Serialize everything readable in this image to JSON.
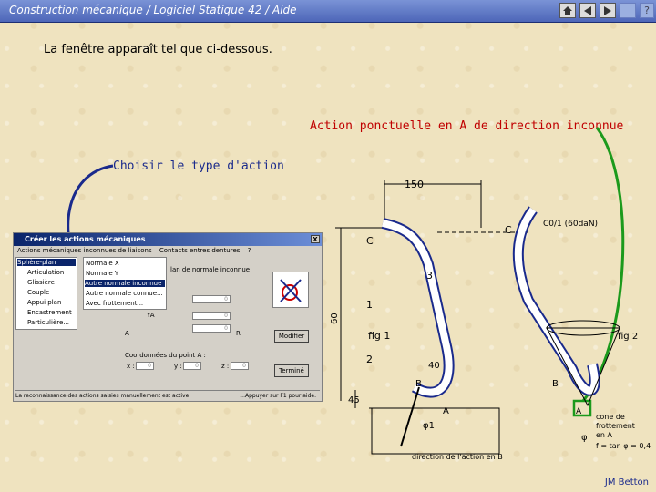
{
  "titlebar": {
    "title_prefix": "Construction mécanique",
    "title_sep": "/",
    "title_main": "Logiciel Statique 42 / Aide",
    "nav_icons": [
      "home-icon",
      "back-icon",
      "forward-icon",
      "blank-icon",
      "help-icon"
    ],
    "help_label": "?"
  },
  "intro": "La fenêtre apparaît tel que ci-dessous.",
  "annotation_red": "Action ponctuelle en A de direction inconnue",
  "annotation_blue": "Choisir le type d'action",
  "dialog": {
    "title": "Créer les actions mécaniques",
    "close": "X",
    "menu": [
      "Actions mécaniques inconnues de liaisons",
      "Contacts entres dentures",
      "?"
    ],
    "submenu1": [
      "Sphère-plan",
      "Articulation",
      "Glissière",
      "Couple",
      "Appui plan",
      "Encastrement",
      "Particulière..."
    ],
    "submenu2": [
      "Normale X",
      "Normale Y",
      "Autre normale inconnue",
      "Autre normale connue...",
      "Avec frottement..."
    ],
    "group_label": "lan de normale inconnue",
    "fields": {
      "zero": "0",
      "YA": "YA",
      "A": "A",
      "R": "R"
    },
    "coords_label": "Coordonnées du point A :",
    "coords": {
      "x_label": "x :",
      "x_val": "0",
      "y_label": "y :",
      "y_val": "0",
      "z_label": "z :",
      "z_val": "0"
    },
    "btn_modifier": "Modifier",
    "btn_termine": "Terminé",
    "status_left": "La reconnaissance des actions saisies manuellement est active",
    "status_right": "...Appuyer sur F1 pour aide."
  },
  "drawing": {
    "labels": [
      "150",
      "C",
      "C",
      "3",
      "1",
      "fig 1",
      "60",
      "2",
      "40",
      "45",
      "B",
      "A",
      "B",
      "fig 2",
      "A",
      "cone de",
      "frottement",
      "en A",
      "f = tan φ = 0,4",
      "direction de l'action en B",
      "C0/1 (60daN)",
      "φ",
      "φ1"
    ]
  },
  "signature": "JM Betton"
}
